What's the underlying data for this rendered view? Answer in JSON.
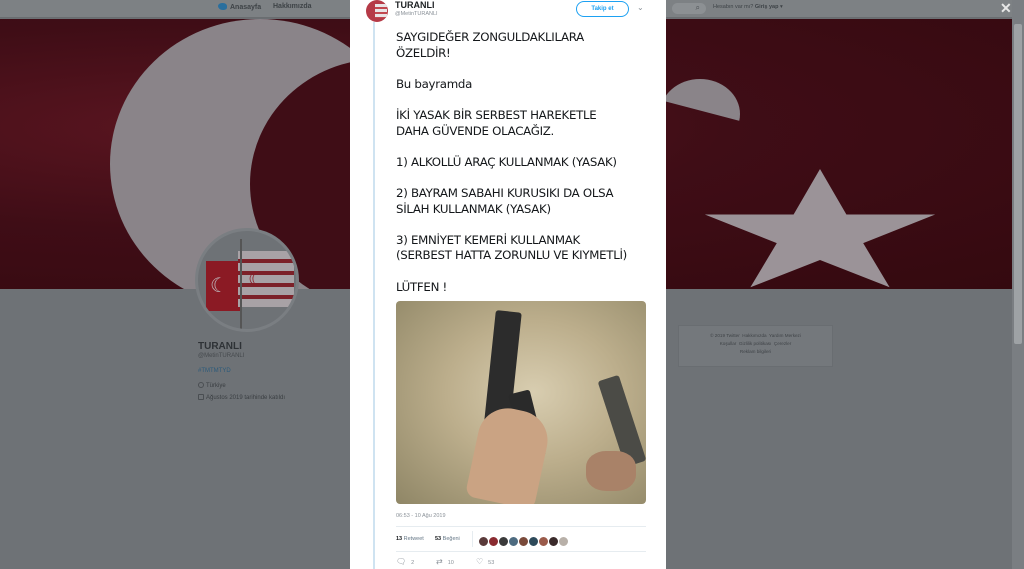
{
  "background_page": {
    "nav": {
      "home_label": "Anasayfa",
      "about_label": "Hakkımızda",
      "login_prefix": "Hesabın var mı?",
      "login_label": "Giriş yap"
    },
    "profile": {
      "name": "TURANLI",
      "handle": "@MetinTURANLI",
      "hashtag": "#TMTMTYD",
      "location": "Türkiye",
      "joined": "Ağustos 2019 tarihinde katıldı"
    },
    "footer_links": [
      "© 2019 Twitter",
      "Hakkımızda",
      "Yardım Merkezi",
      "Koşullar",
      "Gizlilik politikası",
      "Çerezler",
      "Reklam bilgileri"
    ]
  },
  "tweet": {
    "author_name": "TURANLI",
    "author_handle": "@MetinTURANLI",
    "follow_label": "Takip et",
    "paragraphs": [
      "SAYGIDEĞER ZONGULDAKLILARA\nÖZELDİR!",
      "Bu bayramda",
      "İKİ YASAK BİR SERBEST HAREKETLE\nDAHA GÜVENDE OLACAĞIZ.",
      "1) ALKOLLÜ ARAÇ KULLANMAK (YASAK)",
      "2) BAYRAM SABAHI KURUSIKI DA OLSA\nSİLAH KULLANMAK (YASAK)",
      "3) EMNİYET KEMERİ KULLANMAK\n(SERBEST HATTA ZORUNLU VE KIYMETLİ)",
      "LÜTFEN !"
    ],
    "timestamp": "06:53 - 10 Ağu 2019",
    "retweet_count": "13",
    "retweet_label": "Retweet",
    "like_count": "53",
    "like_label": "Beğeni",
    "liker_colors": [
      "#5a3a3a",
      "#8a2b30",
      "#3a3a3a",
      "#4d6b80",
      "#7a4a3a",
      "#2e4a5a",
      "#9a5a4a",
      "#3a2a2a",
      "#b8b0a8"
    ],
    "reply_count": "2",
    "rt_action_count": "10",
    "like_action_count": "53"
  }
}
